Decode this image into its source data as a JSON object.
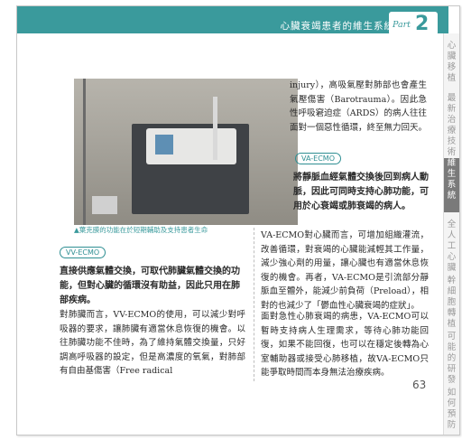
{
  "header": {
    "title": "心臟衰竭患者的維生系統",
    "part_label": "Part",
    "part_number": "2"
  },
  "side_nav": [
    {
      "label": "心臟移植",
      "active": false
    },
    {
      "label": "最新治療技術",
      "active": false
    },
    {
      "label": "維生系統",
      "active": true
    },
    {
      "label": "全人工心臟",
      "active": false
    },
    {
      "label": "幹細胞轉植",
      "active": false
    },
    {
      "label": "可能的研發",
      "active": false
    },
    {
      "label": "如何預防",
      "active": false
    }
  ],
  "figure": {
    "caption": "▲葉克膜的功能在於短期輔助及支持患者生命"
  },
  "section_vv": {
    "label": "VV-ECMO",
    "lead": "直接供應氣體交換，可取代肺臟氣體交換的功能，但對心臟的循環沒有助益，因此只用在肺部疾病。",
    "body": "對肺臟而言，VV-ECMO的使用，可以減少對呼吸器的要求，讓肺臟有適當休息恢復的機會。以往肺臟功能不佳時，為了維持氣體交換量，只好調高呼吸器的設定，但是高濃度的氧氣，對肺部有自由基傷害（Free radical"
  },
  "right_top": {
    "continuation": "injury），高吸氣壓對肺部也會產生氣壓傷害（Barotrauma）。因此急性呼吸窘迫症（ARDS）的病人往往面對一個惡性循環，終至無力回天。"
  },
  "section_va": {
    "label": "VA-ECMO",
    "lead": "將靜脈血經氣體交換後回到病人動脈，因此可同時支持心肺功能，可用於心衰竭或肺衰竭的病人。",
    "body1": "VA-ECMO對心臟而言，可增加組織灌流，改善循環，對衰竭的心臟能減輕其工作量，減少強心劑的用量，讓心臟也有適當休息恢復的機會。再者，VA-ECMO是引流部分靜脈血至體外，能減少前負荷（Preload），相對的也減少了「鬱血性心臟衰竭的症狀」。",
    "body2": "面對急性心肺衰竭的病患，VA-ECMO可以暫時支持病人生理需求，等待心肺功能回復，如果不能回復，也可以在穩定後轉為心室輔助器或接受心肺移植，故VA-ECMO只能爭取時間而本身無法治療疾病。"
  },
  "page_number": "63"
}
